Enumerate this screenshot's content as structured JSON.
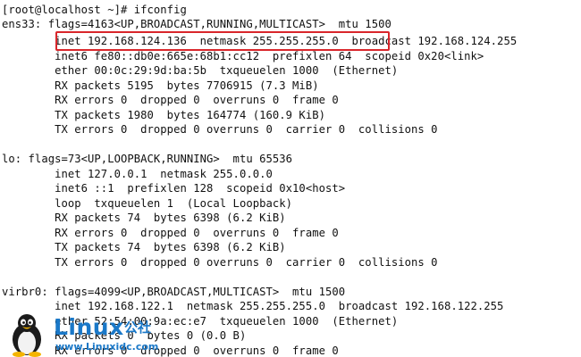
{
  "terminal": {
    "lines": [
      "[root@localhost ~]# ifconfig",
      "ens33: flags=4163<UP,BROADCAST,RUNNING,MULTICAST>  mtu 1500",
      "        inet 192.168.124.136  netmask 255.255.255.0  broadcast 192.168.124.255",
      "        inet6 fe80::db0e:665e:68b1:cc12  prefixlen 64  scopeid 0x20<link>",
      "        ether 00:0c:29:9d:ba:5b  txqueuelen 1000  (Ethernet)",
      "        RX packets 5195  bytes 7706915 (7.3 MiB)",
      "        RX errors 0  dropped 0  overruns 0  frame 0",
      "        TX packets 1980  bytes 164774 (160.9 KiB)",
      "        TX errors 0  dropped 0 overruns 0  carrier 0  collisions 0",
      "",
      "lo: flags=73<UP,LOOPBACK,RUNNING>  mtu 65536",
      "        inet 127.0.0.1  netmask 255.0.0.0",
      "        inet6 ::1  prefixlen 128  scopeid 0x10<host>",
      "        loop  txqueuelen 1  (Local Loopback)",
      "        RX packets 74  bytes 6398 (6.2 KiB)",
      "        RX errors 0  dropped 0  overruns 0  frame 0",
      "        TX packets 74  bytes 6398 (6.2 KiB)",
      "        TX errors 0  dropped 0 overruns 0  carrier 0  collisions 0",
      "",
      "virbr0: flags=4099<UP,BROADCAST,MULTICAST>  mtu 1500",
      "        inet 192.168.122.1  netmask 255.255.255.0  broadcast 192.168.122.255",
      "        ether 52:54:00:9a:ec:e7  txqueuelen 1000  (Ethernet)",
      "        RX packets 0  bytes 0 (0.0 B)",
      "        RX errors 0  dropped 0  overruns 0  frame 0"
    ]
  },
  "watermark": {
    "brand": "Linux",
    "brand_cn": "公社",
    "url": "www.Linuxidc.com"
  },
  "colors": {
    "highlight": "#d9262b",
    "watermark": "#1a78c8",
    "text": "#111111"
  }
}
